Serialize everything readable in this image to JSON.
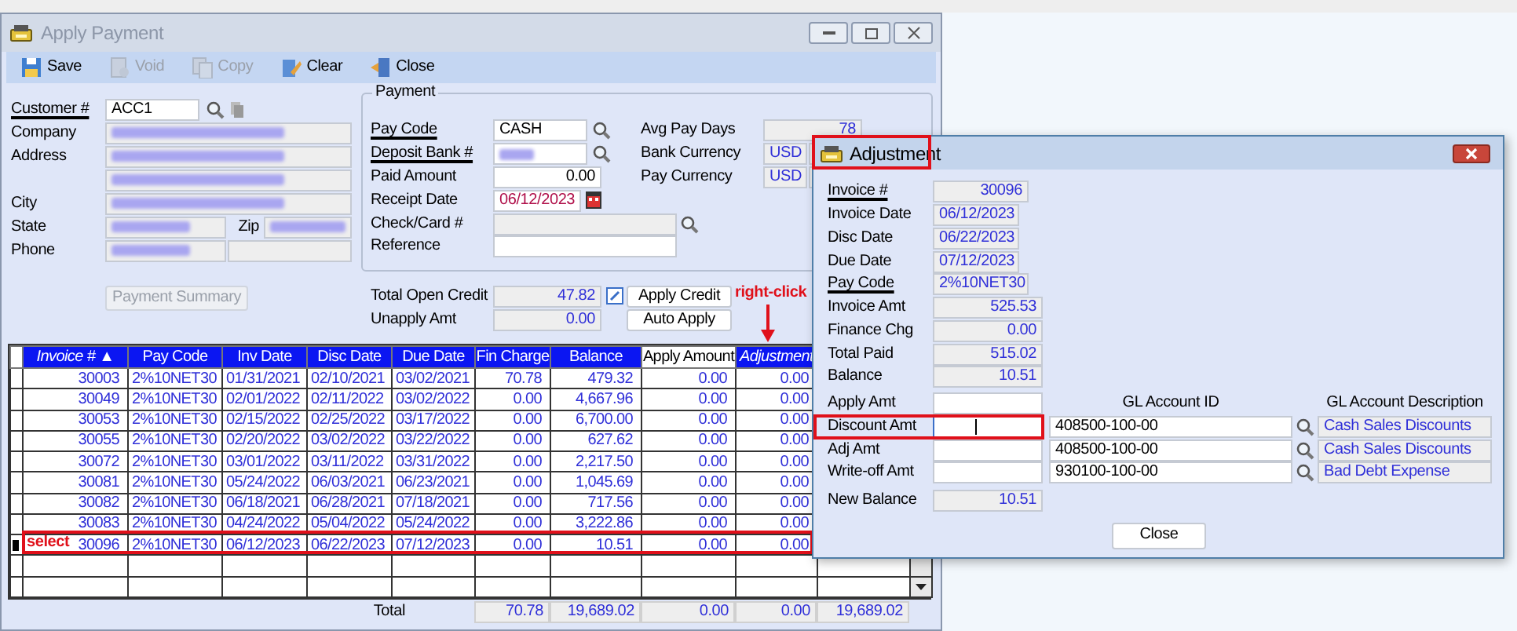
{
  "window": {
    "title": "Apply Payment"
  },
  "toolbar": [
    {
      "label": "Save",
      "disabled": false
    },
    {
      "label": "Void",
      "disabled": true
    },
    {
      "label": "Copy",
      "disabled": true
    },
    {
      "label": "Clear",
      "disabled": false
    },
    {
      "label": "Close",
      "disabled": false
    }
  ],
  "customer": [
    {
      "label": "Customer #",
      "link": true,
      "kind": "lookup",
      "fields": [
        {
          "kind": "text",
          "value": "ACC1",
          "readonly": false
        }
      ]
    },
    {
      "label": "Company",
      "link": false,
      "kind": "plain",
      "fields": [
        {
          "kind": "redacted"
        }
      ]
    },
    {
      "label": "Address",
      "link": false,
      "kind": "plain",
      "fields": [
        {
          "kind": "redacted"
        }
      ]
    },
    {
      "kind": "plain",
      "fields": [
        {
          "kind": "redacted"
        }
      ]
    },
    {
      "label": "City",
      "link": false,
      "kind": "plain",
      "fields": [
        {
          "kind": "redacted"
        }
      ]
    },
    {
      "label": "State",
      "link": false,
      "kind": "plain",
      "fields": [
        {
          "kind": "redacted"
        },
        {
          "kind": "caption",
          "text": "Zip"
        },
        {
          "kind": "redacted"
        }
      ]
    },
    {
      "label": "Phone",
      "link": false,
      "kind": "plain",
      "fields": [
        {
          "kind": "redacted"
        },
        {
          "kind": "blank"
        }
      ]
    }
  ],
  "payment": {
    "title": "Payment",
    "left": [
      {
        "label": "Pay Code",
        "link": true,
        "kind": "lookup",
        "value": "CASH",
        "readonly": false
      },
      {
        "label": "Deposit Bank #",
        "link": true,
        "kind": "lookup-redacted",
        "readonly": false
      },
      {
        "label": "Paid Amount",
        "link": false,
        "kind": "amount",
        "value": "0.00",
        "readonly": false
      },
      {
        "label": "Receipt Date",
        "link": false,
        "kind": "date",
        "value": "06/12/2023",
        "readonly": false
      },
      {
        "label": "Check/Card #",
        "link": false,
        "kind": "wide-lookup",
        "readonly": true
      },
      {
        "label": "Reference",
        "link": false,
        "kind": "wide",
        "readonly": false
      }
    ],
    "right": [
      {
        "label": "Avg Pay Days",
        "kind": "number",
        "value": "78"
      },
      {
        "label": "Bank Currency",
        "kind": "currency",
        "value": "USD"
      },
      {
        "label": "Pay Currency",
        "kind": "currency",
        "value": "USD"
      }
    ]
  },
  "summary_button": {
    "label": "Payment Summary",
    "disabled": true
  },
  "credit": [
    {
      "label": "Total Open Credit",
      "value": "47.82",
      "kind": "edit",
      "button": "Apply Credit"
    },
    {
      "label": "Unapply Amt",
      "value": "0.00",
      "kind": "plain",
      "button": "Auto Apply"
    }
  ],
  "grid": {
    "columns": [
      {
        "label": "Invoice # ▲",
        "italic": true,
        "editable": false
      },
      {
        "label": "Pay Code",
        "italic": false,
        "editable": false
      },
      {
        "label": "Inv Date",
        "italic": false,
        "editable": false
      },
      {
        "label": "Disc Date",
        "italic": false,
        "editable": false
      },
      {
        "label": "Due Date",
        "italic": false,
        "editable": false
      },
      {
        "label": "Fin Charge",
        "italic": false,
        "editable": false
      },
      {
        "label": "Balance",
        "italic": false,
        "editable": false
      },
      {
        "label": "Apply Amount",
        "italic": false,
        "editable": true
      },
      {
        "label": "Adjustment",
        "italic": true,
        "editable": false
      }
    ],
    "rows": [
      {
        "selected": false,
        "cells": [
          "30003",
          "2%10NET30",
          "01/31/2021",
          "02/10/2021",
          "03/02/2021",
          "70.78",
          "479.32",
          "0.00",
          "0.00"
        ]
      },
      {
        "selected": false,
        "cells": [
          "30049",
          "2%10NET30",
          "02/01/2022",
          "02/11/2022",
          "03/02/2022",
          "0.00",
          "4,667.96",
          "0.00",
          "0.00"
        ]
      },
      {
        "selected": false,
        "cells": [
          "30053",
          "2%10NET30",
          "02/15/2022",
          "02/25/2022",
          "03/17/2022",
          "0.00",
          "6,700.00",
          "0.00",
          "0.00"
        ]
      },
      {
        "selected": false,
        "cells": [
          "30055",
          "2%10NET30",
          "02/20/2022",
          "03/02/2022",
          "03/22/2022",
          "0.00",
          "627.62",
          "0.00",
          "0.00"
        ]
      },
      {
        "selected": false,
        "cells": [
          "30072",
          "2%10NET30",
          "03/01/2022",
          "03/11/2022",
          "03/31/2022",
          "0.00",
          "2,217.50",
          "0.00",
          "0.00"
        ]
      },
      {
        "selected": false,
        "cells": [
          "30081",
          "2%10NET30",
          "05/24/2022",
          "06/03/2021",
          "06/23/2021",
          "0.00",
          "1,045.69",
          "0.00",
          "0.00"
        ]
      },
      {
        "selected": false,
        "cells": [
          "30082",
          "2%10NET30",
          "06/18/2021",
          "06/28/2021",
          "07/18/2021",
          "0.00",
          "717.56",
          "0.00",
          "0.00"
        ]
      },
      {
        "selected": false,
        "cells": [
          "30083",
          "2%10NET30",
          "04/24/2022",
          "05/04/2022",
          "05/24/2022",
          "0.00",
          "3,222.86",
          "0.00",
          "0.00"
        ]
      },
      {
        "selected": true,
        "cells": [
          "30096",
          "2%10NET30",
          "06/12/2023",
          "06/22/2023",
          "07/12/2023",
          "0.00",
          "10.51",
          "0.00",
          "0.00"
        ]
      }
    ],
    "totals": {
      "label": "Total",
      "values": [
        "70.78",
        "19,689.02",
        "0.00",
        "0.00",
        "19,689.02"
      ]
    }
  },
  "adjustment": {
    "title": "Adjustment",
    "fields": [
      {
        "label": "Invoice #",
        "link": true,
        "kind": "code",
        "value": "30096"
      },
      {
        "label": "Invoice Date",
        "link": false,
        "kind": "date",
        "value": "06/12/2023"
      },
      {
        "label": "Disc Date",
        "link": false,
        "kind": "date",
        "value": "06/22/2023"
      },
      {
        "label": "Due Date",
        "link": false,
        "kind": "date",
        "value": "07/12/2023"
      },
      {
        "label": "Pay Code",
        "link": true,
        "kind": "text",
        "value": "2%10NET30"
      },
      {
        "label": "Invoice Amt",
        "link": false,
        "kind": "amount",
        "value": "525.53"
      },
      {
        "label": "Finance Chg",
        "link": false,
        "kind": "amount",
        "value": "0.00"
      },
      {
        "label": "Total Paid",
        "link": false,
        "kind": "amount",
        "value": "515.02"
      },
      {
        "label": "Balance",
        "link": false,
        "kind": "amount",
        "value": "10.51"
      }
    ],
    "gl_headers": [
      "GL Account ID",
      "GL Account Description"
    ],
    "entries": [
      {
        "label": "Apply Amt",
        "kind": "plain",
        "focused": false
      },
      {
        "label": "Discount Amt",
        "kind": "gl",
        "focused": true,
        "account": "408500-100-00",
        "description": "Cash Sales Discounts"
      },
      {
        "label": "Adj Amt",
        "kind": "gl",
        "focused": false,
        "account": "408500-100-00",
        "description": "Cash Sales Discounts"
      },
      {
        "label": "Write-off Amt",
        "kind": "gl",
        "focused": false,
        "account": "930100-100-00",
        "description": "Bad Debt Expense"
      }
    ],
    "new_balance": {
      "label": "New Balance",
      "value": "10.51"
    },
    "close_button": "Close"
  },
  "annotations": [
    {
      "text": "right-click"
    },
    {
      "text": "select"
    }
  ]
}
